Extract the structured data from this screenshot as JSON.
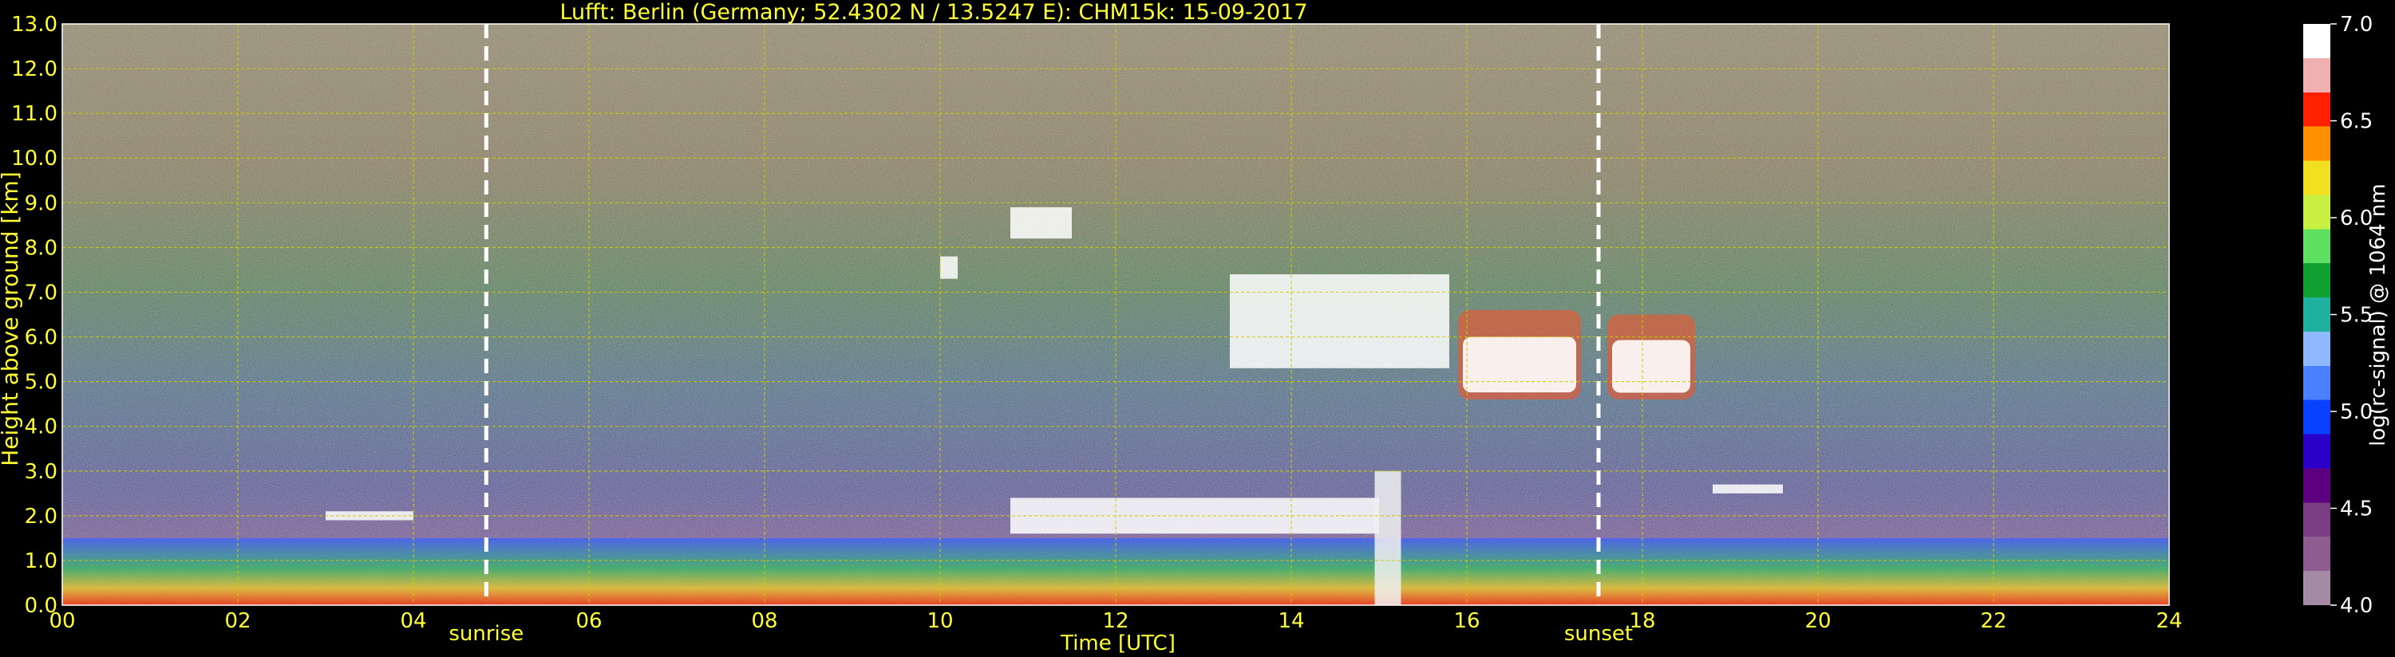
{
  "chart_data": {
    "type": "heatmap",
    "title": "Lufft: Berlin (Germany; 52.4302 N / 13.5247 E):    CHM15k: 15-09-2017",
    "xlabel": "Time [UTC]",
    "ylabel": "Height above ground [km]",
    "colorbar_label": "log(rc-signal) @ 1064 nm",
    "xlim": [
      0,
      24
    ],
    "ylim": [
      0,
      13
    ],
    "x_ticks": [
      "00",
      "02",
      "04",
      "06",
      "08",
      "10",
      "12",
      "14",
      "16",
      "18",
      "20",
      "22",
      "24"
    ],
    "y_ticks": [
      "0.0",
      "1.0",
      "2.0",
      "3.0",
      "4.0",
      "5.0",
      "6.0",
      "7.0",
      "8.0",
      "9.0",
      "10.0",
      "11.0",
      "12.0",
      "13.0"
    ],
    "colorbar_ticks": [
      "4.0",
      "4.5",
      "5.0",
      "5.5",
      "6.0",
      "6.5",
      "7.0"
    ],
    "colorbar_range": [
      4.0,
      7.0
    ],
    "grid": true,
    "markers": [
      {
        "label": "sunrise",
        "time": 4.83
      },
      {
        "label": "sunset",
        "time": 17.5
      }
    ],
    "colors": {
      "background": "#000000",
      "axis_text": "#ffff33",
      "grid": "#cccc00",
      "colormap": [
        "#a48aa4",
        "#8e5c8e",
        "#7a3c82",
        "#5c0080",
        "#2a00c8",
        "#0a40ff",
        "#4a80ff",
        "#90b8ff",
        "#20b0a0",
        "#10a030",
        "#60e060",
        "#c8f040",
        "#f0e020",
        "#ff9000",
        "#ff2000",
        "#f0b0b0",
        "#ffffff"
      ]
    },
    "features": [
      {
        "kind": "boundary layer",
        "time": [
          0,
          24
        ],
        "height_km": [
          0,
          1.5
        ]
      },
      {
        "kind": "cloud layer",
        "time": [
          15.9,
          17.3
        ],
        "height_km": [
          4.6,
          6.6
        ]
      },
      {
        "kind": "cloud layer",
        "time": [
          17.6,
          18.6
        ],
        "height_km": [
          4.6,
          6.5
        ]
      },
      {
        "kind": "cloud top",
        "time": [
          3.0,
          4.0
        ],
        "height_km": [
          1.9,
          2.1
        ]
      },
      {
        "kind": "cloud top",
        "time": [
          10.8,
          15.0
        ],
        "height_km": [
          1.6,
          2.4
        ]
      },
      {
        "kind": "precipitation fall streak",
        "time": [
          14.95,
          15.25
        ],
        "height_km": [
          0,
          3.0
        ]
      },
      {
        "kind": "cirrus",
        "time": [
          10.0,
          10.2
        ],
        "height_km": [
          7.3,
          7.8
        ]
      },
      {
        "kind": "cirrus",
        "time": [
          10.8,
          11.5
        ],
        "height_km": [
          8.2,
          8.9
        ]
      },
      {
        "kind": "cirrus",
        "time": [
          13.3,
          15.8
        ],
        "height_km": [
          5.3,
          7.4
        ]
      },
      {
        "kind": "cloud top",
        "time": [
          18.8,
          19.6
        ],
        "height_km": [
          2.5,
          2.7
        ]
      }
    ]
  }
}
